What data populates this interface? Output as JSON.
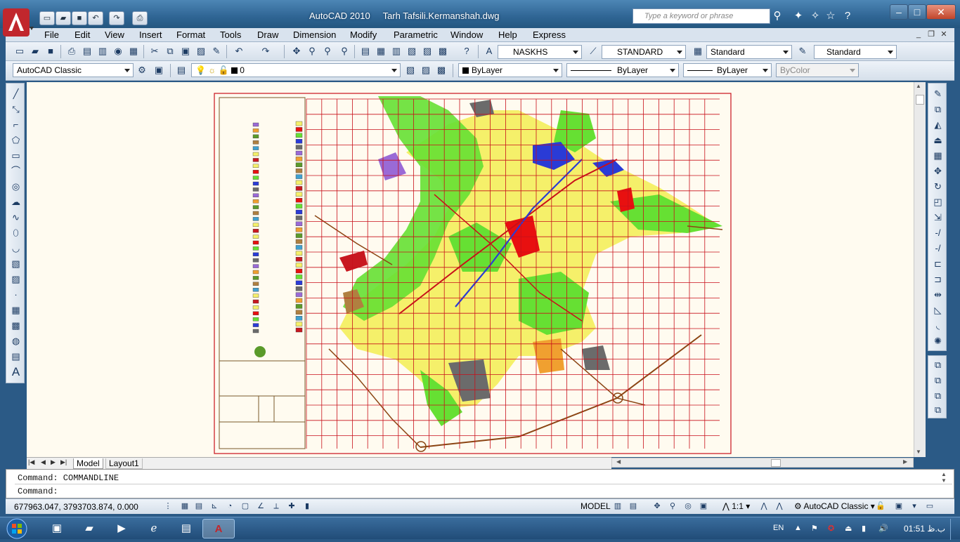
{
  "window": {
    "app_name": "AutoCAD 2010",
    "file_name": "Tarh Tafsili.Kermanshah.dwg",
    "search_placeholder": "Type a keyword or phrase",
    "minimize": "–",
    "maximize": "□",
    "close": "✕"
  },
  "menu": [
    "File",
    "Edit",
    "View",
    "Insert",
    "Format",
    "Tools",
    "Draw",
    "Dimension",
    "Modify",
    "Parametric",
    "Window",
    "Help",
    "Express"
  ],
  "styles_toolbar": {
    "text_style": "NASKHS",
    "dim_style": "STANDARD",
    "table_style": "Standard",
    "multileader_style": "Standard"
  },
  "layers_toolbar": {
    "workspace": "AutoCAD Classic",
    "current_layer": "0",
    "color": "ByLayer",
    "linetype": "ByLayer",
    "lineweight": "ByLayer",
    "plot_style": "ByColor"
  },
  "tabs": {
    "model": "Model",
    "layout1": "Layout1"
  },
  "command": {
    "history": "Command: COMMANDLINE",
    "prompt": "Command:"
  },
  "status": {
    "coordinates": "677963.047, 3793703.874, 0.000",
    "model_label": "MODEL",
    "annotation_scale": "1:1",
    "workspace_label": "AutoCAD Classic"
  },
  "taskbar": {
    "language": "EN",
    "clock_time": "01:51",
    "clock_suffix": "ب.ظ"
  },
  "colors": {
    "drawing_background": "#fffbf0",
    "grid_red": "#c8101a",
    "green_area": "#66e033",
    "yellow_area": "#f5f06a",
    "title_bar": "#2f6594"
  }
}
